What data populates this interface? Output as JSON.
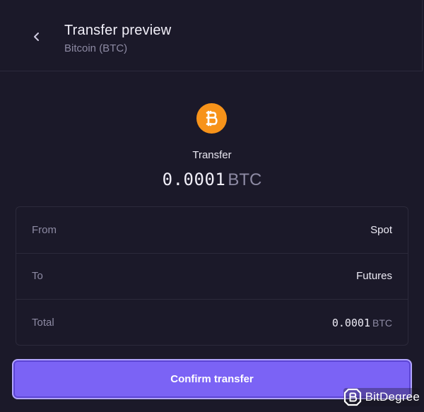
{
  "header": {
    "title": "Transfer preview",
    "subtitle": "Bitcoin (BTC)"
  },
  "transfer": {
    "label": "Transfer",
    "amount": "0.0001",
    "unit": "BTC"
  },
  "details": [
    {
      "label": "From",
      "value": "Spot"
    },
    {
      "label": "To",
      "value": "Futures"
    },
    {
      "label": "Total",
      "value": "0.0001",
      "unit": "BTC"
    }
  ],
  "confirm": {
    "label": "Confirm transfer"
  },
  "watermark": {
    "text": "BitDegree"
  },
  "colors": {
    "background": "#1b1929",
    "accent": "#7b63f5",
    "bitcoin": "#f7931a",
    "muted_text": "#8d8aa3"
  },
  "icons": {
    "back": "chevron-left-icon",
    "coin": "bitcoin-icon"
  }
}
